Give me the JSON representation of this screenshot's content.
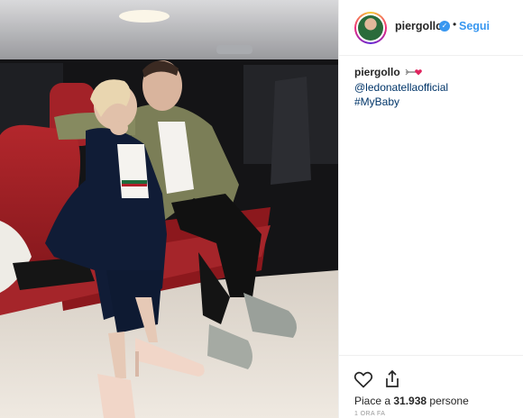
{
  "post": {
    "username": "piergollo",
    "follow_label": "Segui",
    "separator": "•",
    "caption": {
      "username": "piergollo",
      "mention": "@ledonatellaofficial",
      "hashtag": "#MyBaby"
    },
    "likes_prefix": "Piace a ",
    "likes_count": "31.938",
    "likes_suffix": " persone",
    "time": "1 ORA FA",
    "icons": [
      "verified-badge-icon",
      "heart-icon",
      "share-icon",
      "arrow-heart-emoji-icon"
    ],
    "colors": {
      "link": "#3897f0",
      "hashtag": "#003569",
      "text": "#262626",
      "muted": "#999999"
    }
  }
}
